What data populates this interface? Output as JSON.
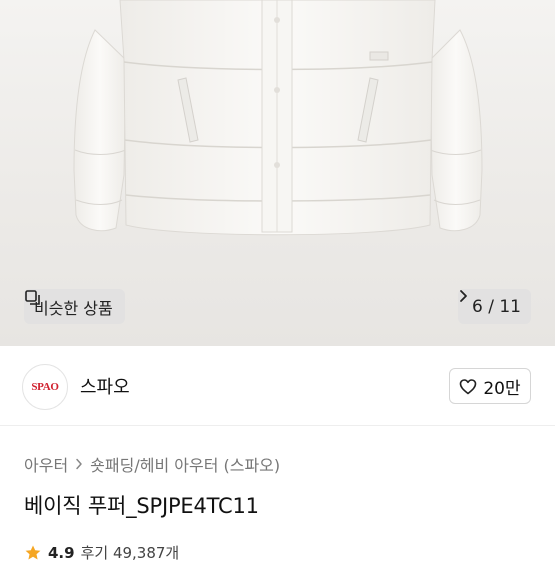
{
  "gallery": {
    "similar_label": "비슷한 상품",
    "current": "6",
    "total": "11",
    "counter_text": "6 / 11"
  },
  "shop": {
    "logo_text": "SPAO",
    "name": "스파오",
    "like_count": "20만"
  },
  "breadcrumb": {
    "items": [
      "아우터",
      "숏패딩/헤비 아우터 (스파오)"
    ]
  },
  "product": {
    "title": "베이직 푸퍼_SPJPE4TC11",
    "rating": "4.9",
    "review_label": "후기 49,387개"
  },
  "colors": {
    "brand_red": "#d0202e",
    "star": "#f5a623"
  }
}
